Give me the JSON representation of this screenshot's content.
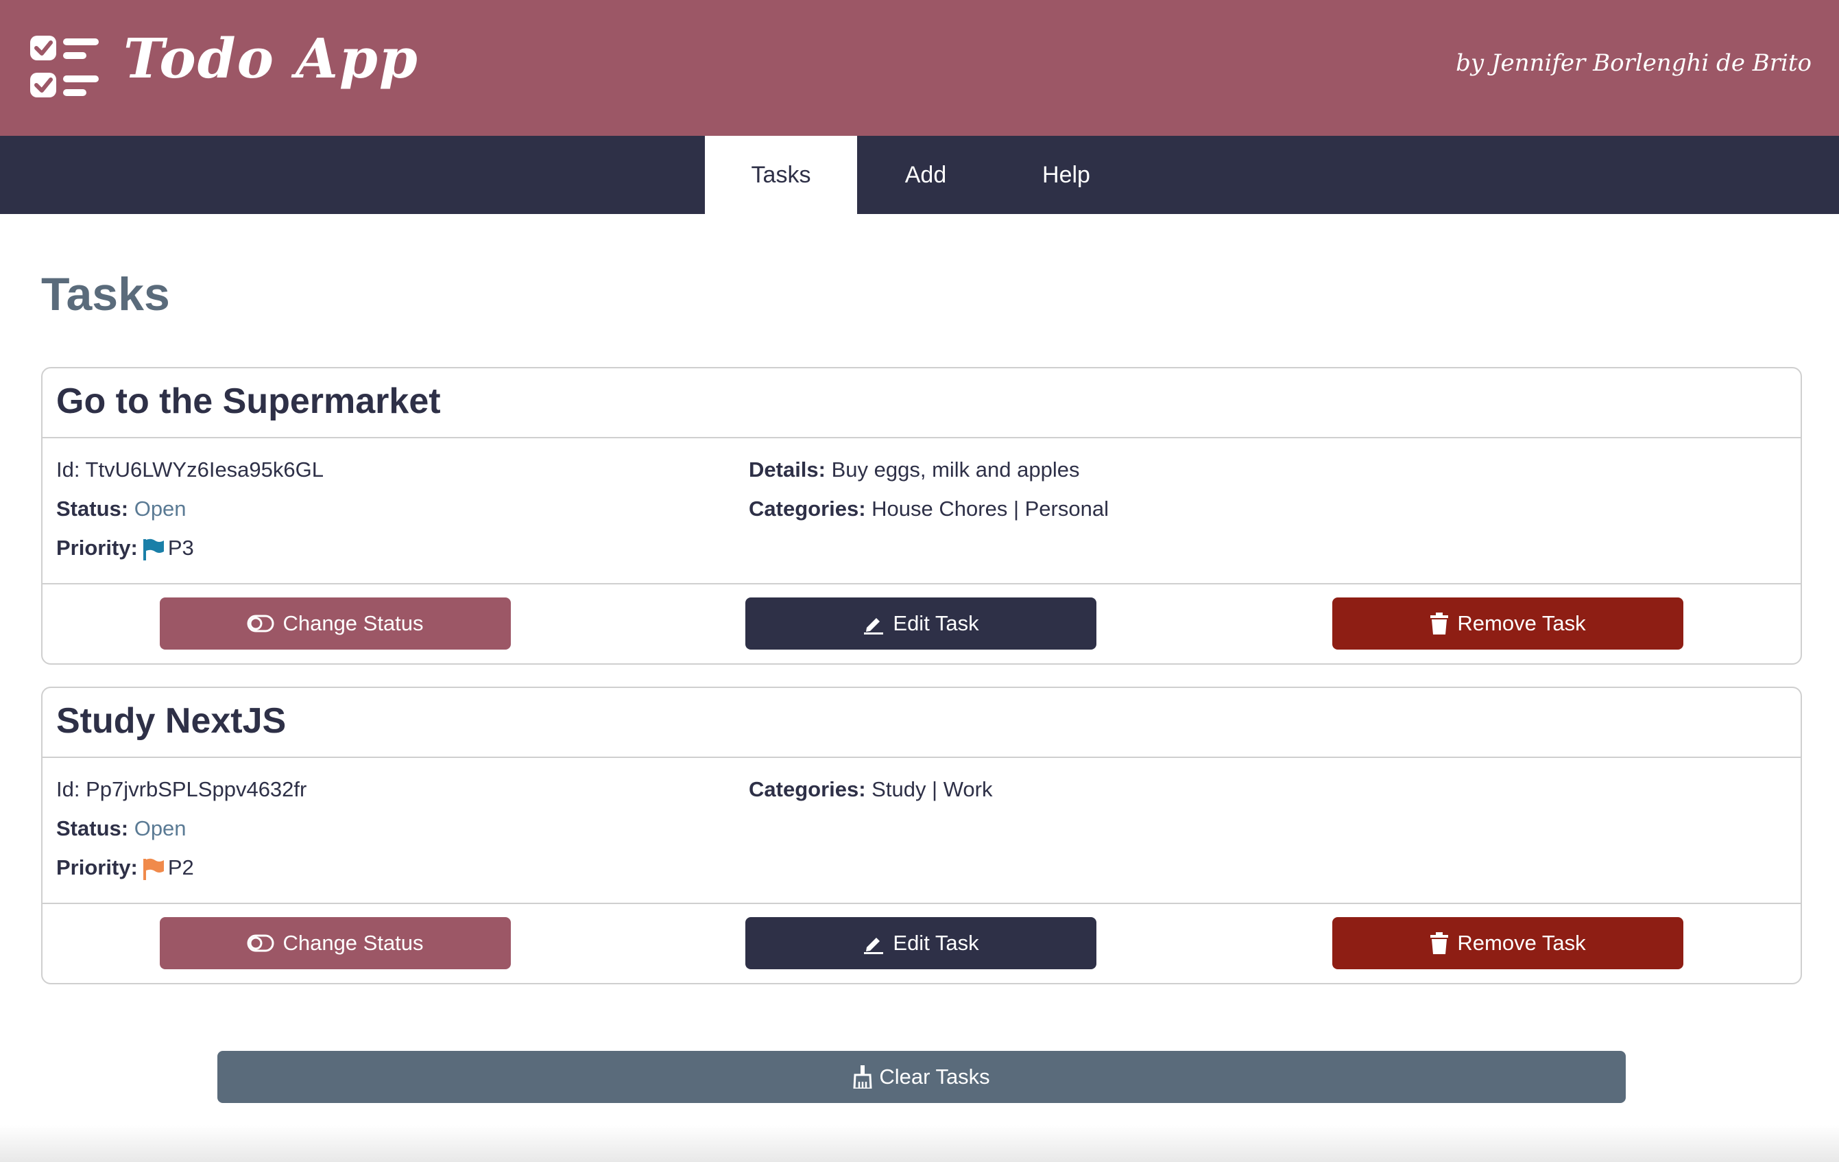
{
  "header": {
    "app_title": "Todo App",
    "author": "by Jennifer Borlenghi de Brito"
  },
  "nav": {
    "tabs": [
      {
        "label": "Tasks",
        "active": true
      },
      {
        "label": "Add",
        "active": false
      },
      {
        "label": "Help",
        "active": false
      }
    ]
  },
  "page": {
    "title": "Tasks"
  },
  "labels": {
    "id_prefix": "Id:",
    "status": "Status:",
    "priority": "Priority:",
    "details": "Details:",
    "categories": "Categories:"
  },
  "tasks": [
    {
      "title": "Go to the Supermarket",
      "id": "TtvU6LWYz6Iesa95k6GL",
      "status": "Open",
      "priority": "P3",
      "priority_color": "#1a7fa8",
      "details": "Buy eggs, milk and apples",
      "categories": "House Chores | Personal"
    },
    {
      "title": "Study NextJS",
      "id": "Pp7jvrbSPLSppv4632fr",
      "status": "Open",
      "priority": "P2",
      "priority_color": "#f08a4b",
      "categories": "Study | Work"
    }
  ],
  "buttons": {
    "change_status": "Change Status",
    "edit_task": "Edit Task",
    "remove_task": "Remove Task",
    "clear_tasks": "Clear Tasks"
  },
  "colors": {
    "header_bg": "#9c5766",
    "nav_bg": "#2e3047",
    "remove_bg": "#8e1e14",
    "clear_bg": "#5a6b7b"
  }
}
